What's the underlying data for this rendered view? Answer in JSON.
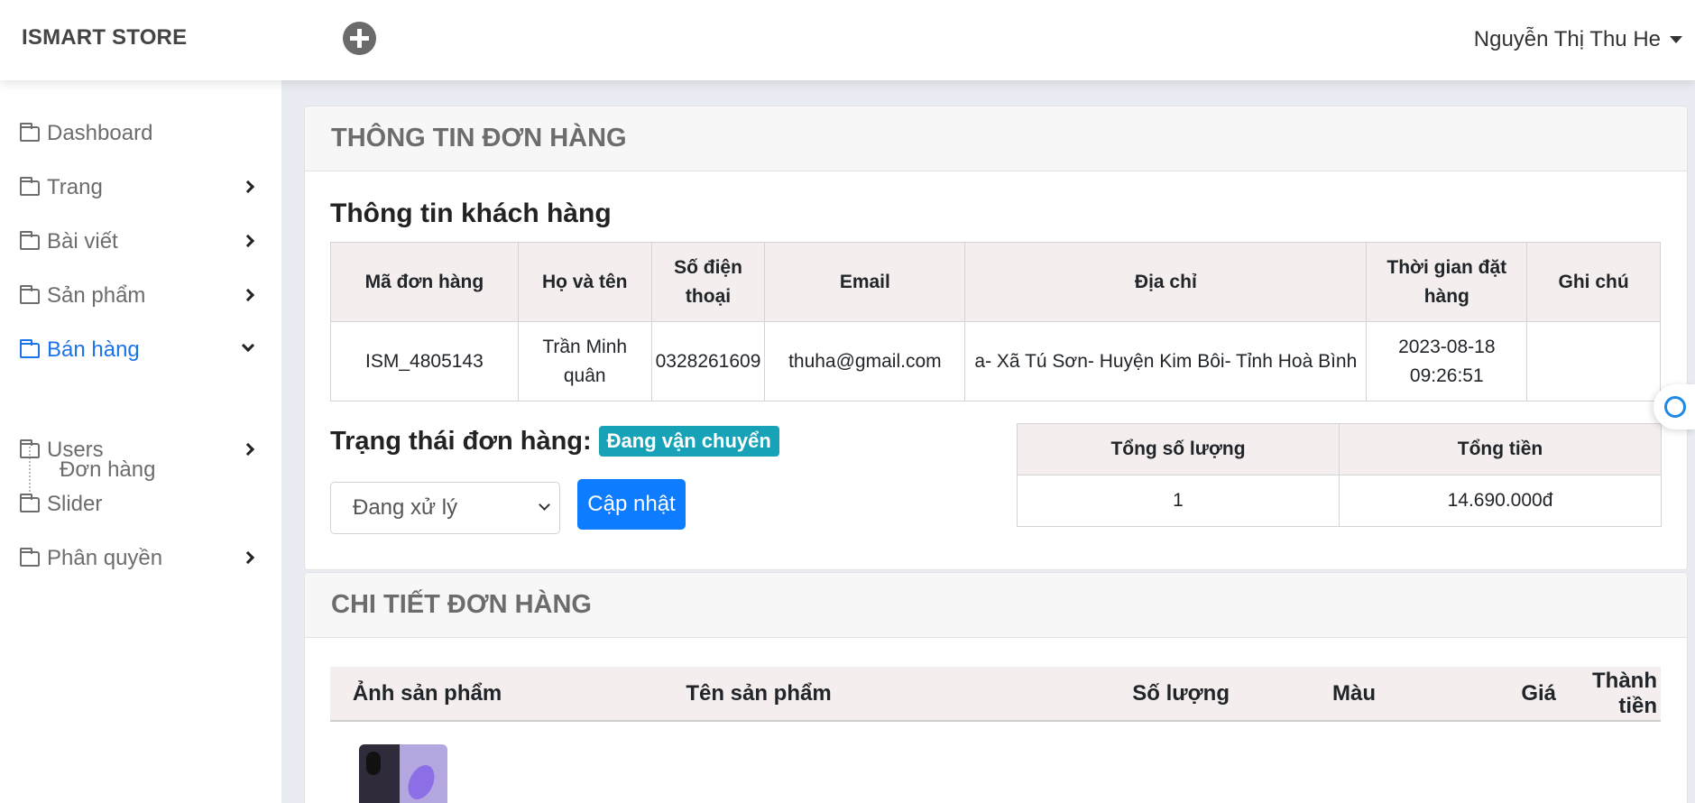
{
  "topbar": {
    "brand": "ISMART STORE",
    "user_name": "Nguyễn Thị Thu He"
  },
  "sidebar": {
    "items": [
      {
        "label": "Dashboard"
      },
      {
        "label": "Trang"
      },
      {
        "label": "Bài viết"
      },
      {
        "label": "Sản phẩm"
      },
      {
        "label": "Bán hàng"
      },
      {
        "label": "Users"
      },
      {
        "label": "Slider"
      },
      {
        "label": "Phân quyền"
      }
    ],
    "subitem": "Đơn hàng"
  },
  "order_info": {
    "title": "THÔNG TIN ĐƠN HÀNG",
    "customer_heading": "Thông tin khách hàng",
    "headers": [
      "Mã đơn hàng",
      "Họ và tên",
      "Số điện thoại",
      "Email",
      "Địa chỉ",
      "Thời gian đặt hàng",
      "Ghi chú"
    ],
    "row": {
      "order_code": "ISM_4805143",
      "name": "Trần Minh quân",
      "phone": "0328261609",
      "email": "thuha@gmail.com",
      "address": "a- Xã Tú Sơn- Huyện Kim Bôi- Tỉnh Hoà Bình",
      "time": "2023-08-18 09:26:51",
      "note": ""
    },
    "status_label": "Trạng thái đơn hàng:",
    "status_value": "Đang vận chuyển",
    "status_color": "#17a2b8",
    "select_value": "Đang xử lý",
    "update_button": "Cập nhật",
    "totals_headers": [
      "Tổng số lượng",
      "Tổng tiền"
    ],
    "totals": {
      "quantity": "1",
      "amount": "14.690.000đ"
    }
  },
  "order_detail": {
    "title": "CHI TIẾT ĐƠN HÀNG",
    "headers": [
      "Ảnh sản phẩm",
      "Tên sản phẩm",
      "Số lượng",
      "Màu",
      "Giá",
      "Thành tiền"
    ]
  },
  "icons": [
    "add-circle-icon",
    "caret-down-icon",
    "folder-icon",
    "chevron-right-icon",
    "chevron-down-icon",
    "assistant-icon"
  ]
}
